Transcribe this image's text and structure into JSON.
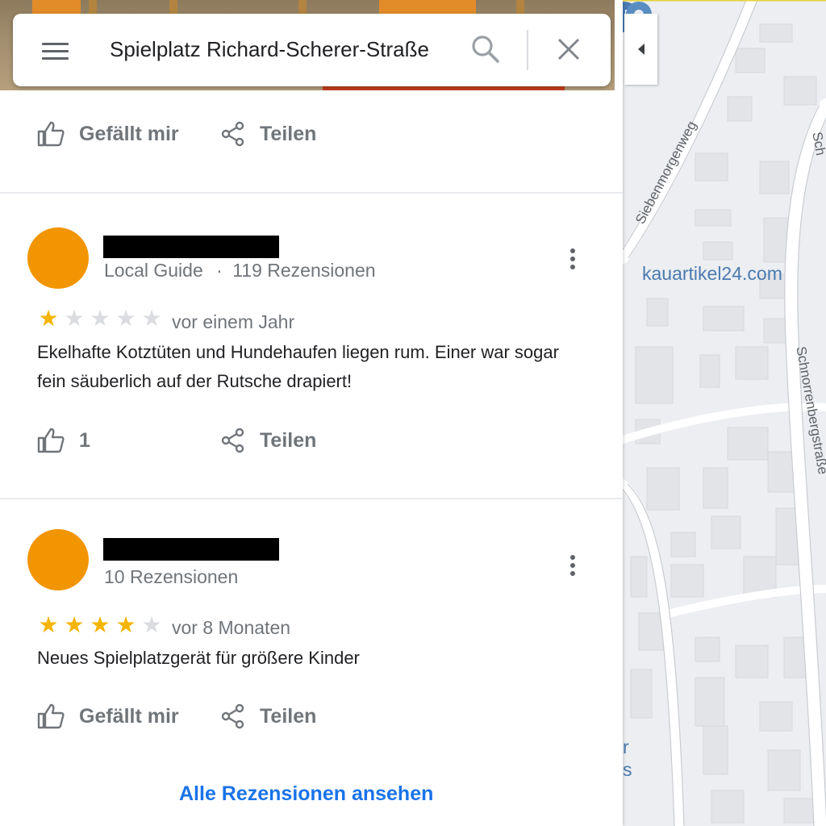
{
  "search": {
    "query": "Spielplatz Richard-Scherer-Straße",
    "menu_icon": "hamburger-menu-icon",
    "search_icon": "magnifier-icon",
    "close_icon": "close-x-icon"
  },
  "place_actions": {
    "like_label": "Gefällt mir",
    "share_label": "Teilen"
  },
  "reviews": [
    {
      "author_meta_guide": "Local Guide",
      "author_meta_dot": "·",
      "author_meta_count": "119 Rezensionen",
      "rating": 1,
      "date": "vor einem Jahr",
      "text": "Ekelhafte Kotztüten und Hundehaufen liegen rum. Einer war sogar fein säuberlich auf der Rutsche drapiert!",
      "like_count": "1",
      "share_label": "Teilen"
    },
    {
      "author_meta_count": "10 Rezensionen",
      "rating": 4,
      "date": "vor 8 Monaten",
      "text": "Neues Spielplatzgerät für größere Kinder",
      "like_label": "Gefällt mir",
      "share_label": "Teilen"
    }
  ],
  "all_reviews_link": "Alle Rezensionen ansehen",
  "map": {
    "streets": [
      "Siebenmorgenweg",
      "Schnorrenbergstraße",
      "Sch"
    ],
    "poi": "kauartikel24.com",
    "edge_text": [
      "r",
      "s"
    ]
  },
  "colors": {
    "accent": "#1a73e8",
    "avatar": "#f29503",
    "star": "#f5b400"
  }
}
